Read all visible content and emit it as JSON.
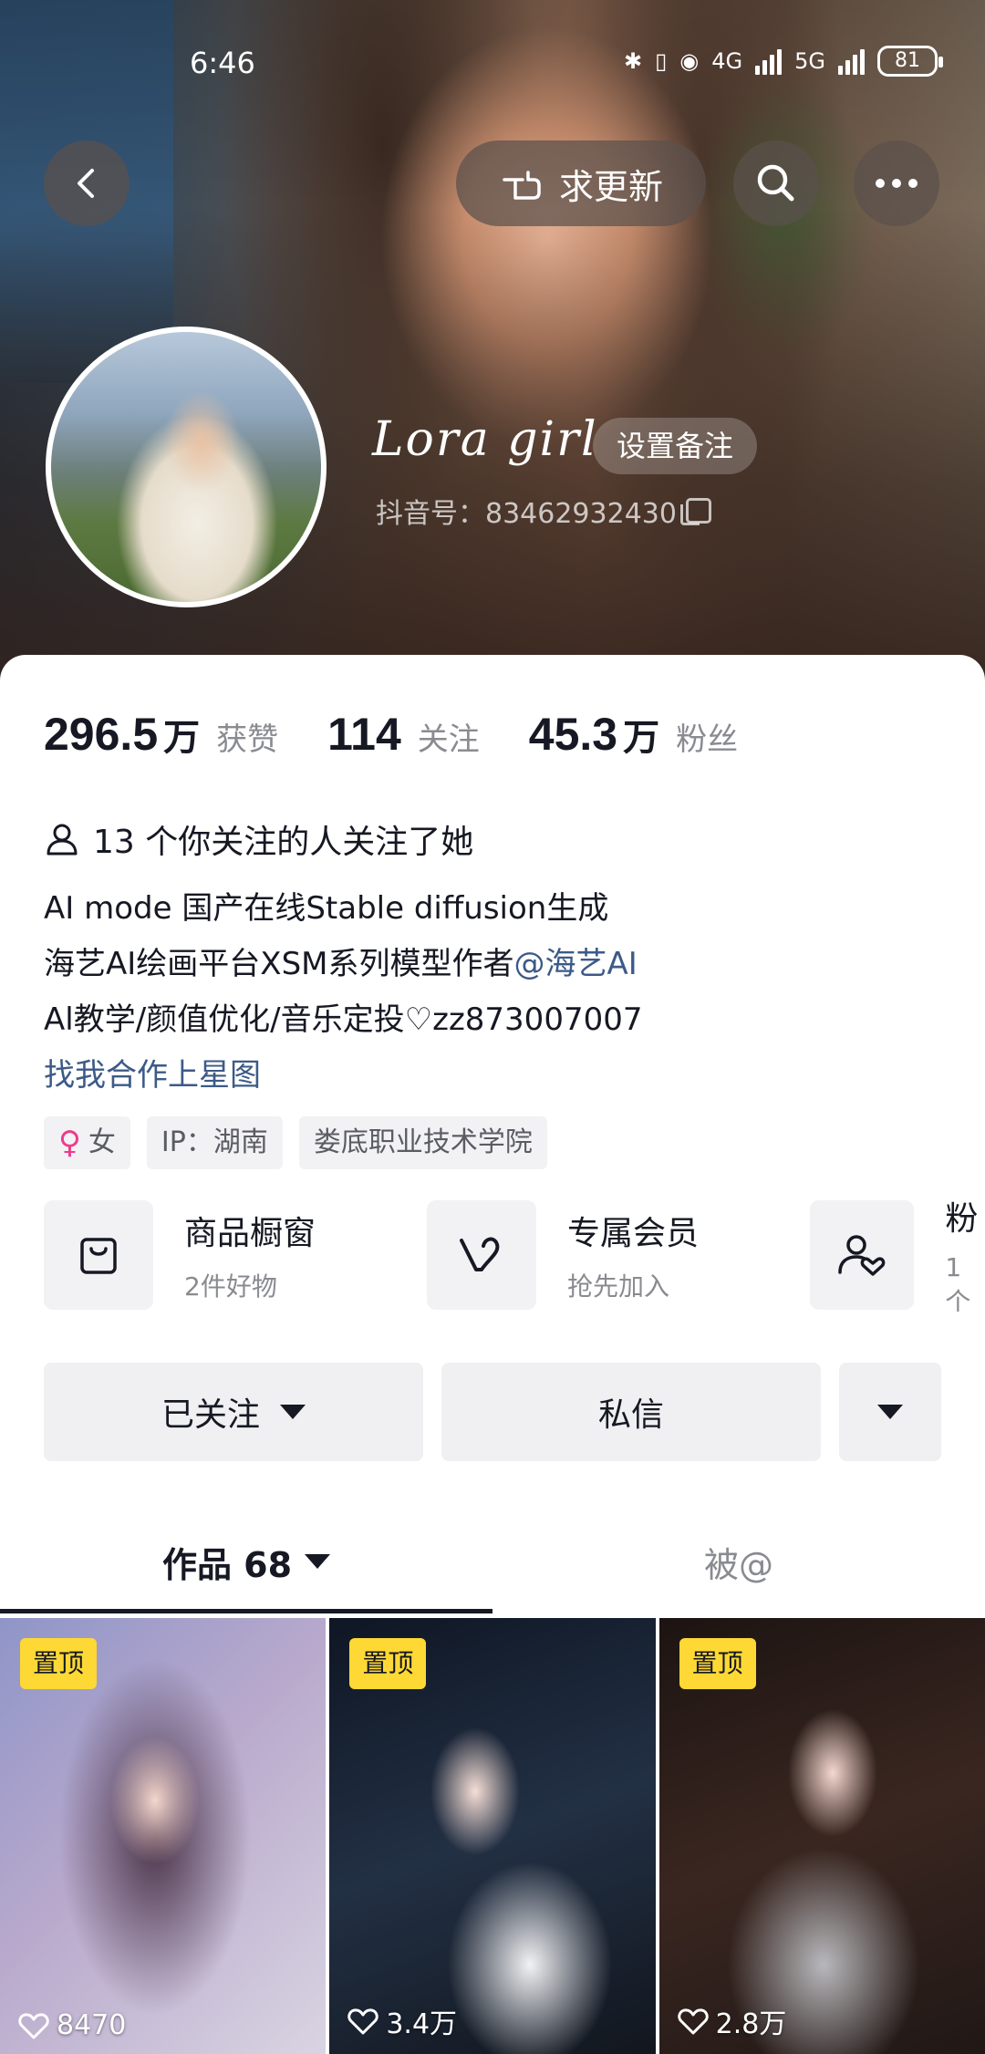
{
  "status_bar": {
    "time": "6:46",
    "network_1": "4G",
    "network_2": "5G",
    "battery": "81"
  },
  "header": {
    "update_label": "求更新"
  },
  "profile": {
    "nickname": "Lora girl",
    "remark_label": "设置备注",
    "douyin_id": "抖音号：83462932430"
  },
  "stats": {
    "likes": {
      "num": "296.5",
      "unit": "万",
      "label": "获赞"
    },
    "following": {
      "num": "114",
      "unit": "",
      "label": "关注"
    },
    "followers": {
      "num": "45.3",
      "unit": "万",
      "label": "粉丝"
    }
  },
  "mutual_text": "13 个你关注的人关注了她",
  "bio": {
    "line1": "AI mode 国产在线Stable diffusion生成",
    "line2_prefix": "海艺AI绘画平台XSM系列模型作者",
    "line2_mention": "@海艺AI",
    "line3": "Al教学/颜值优化/音乐定投♡zz873007007",
    "link": "找我合作上星图"
  },
  "tags": {
    "gender": "女",
    "ip": "IP：湖南",
    "school": "娄底职业技术学院"
  },
  "services": [
    {
      "title": "商品橱窗",
      "sub": "2件好物",
      "icon": "bag-icon"
    },
    {
      "title": "专属会员",
      "sub": "抢先加入",
      "icon": "v-heart-icon"
    },
    {
      "title": "粉",
      "sub": "1个",
      "icon": "fan-group-icon"
    }
  ],
  "actions": {
    "followed_label": "已关注",
    "message_label": "私信"
  },
  "tabs": {
    "works_label": "作品 68",
    "mentioned_label": "被@"
  },
  "videos": [
    {
      "pin": "置顶",
      "likes": "8470"
    },
    {
      "pin": "置顶",
      "likes": "3.4万"
    },
    {
      "pin": "置顶",
      "likes": "2.8万"
    }
  ],
  "colors": {
    "accent_link": "#3c5a88",
    "pin_badge": "#fed834",
    "female": "#ee3c8c"
  }
}
